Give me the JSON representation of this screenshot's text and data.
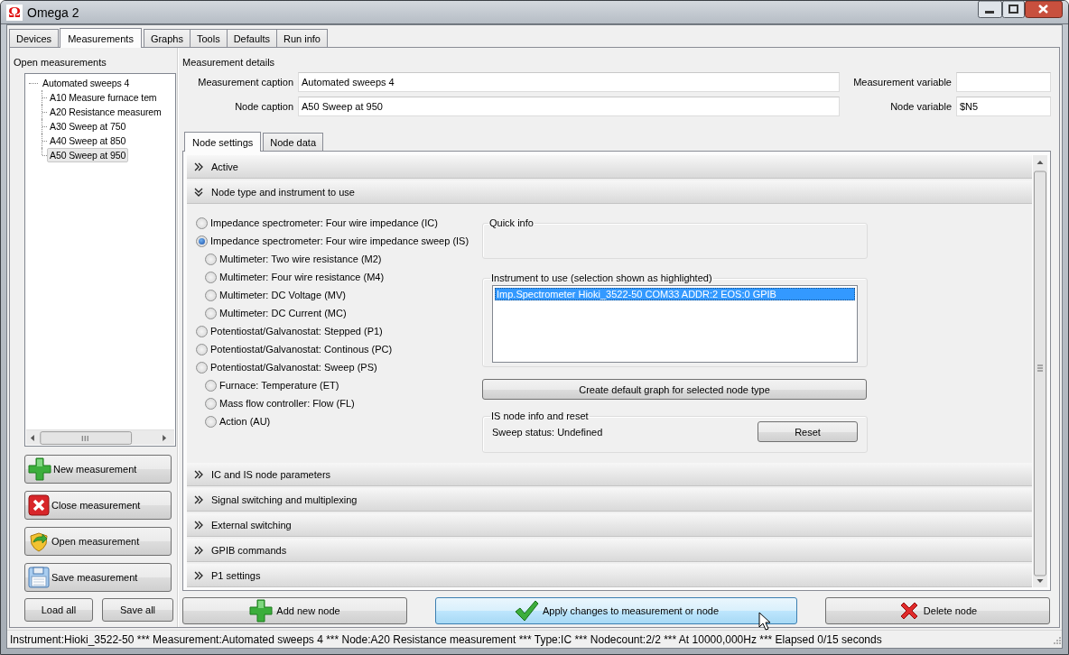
{
  "window": {
    "logo": "Ω",
    "title": "Omega 2"
  },
  "tabs": [
    {
      "label": "Devices",
      "selected": false
    },
    {
      "label": "Measurements",
      "selected": true
    },
    {
      "label": "Graphs",
      "selected": false
    },
    {
      "label": "Tools",
      "selected": false
    },
    {
      "label": "Defaults",
      "selected": false
    },
    {
      "label": "Run info",
      "selected": false
    }
  ],
  "open_measurements": {
    "title": "Open measurements",
    "tree": [
      {
        "label": "Automated sweeps 4",
        "selected": false,
        "children": [
          {
            "label": "A10 Measure furnace tem",
            "selected": false
          },
          {
            "label": "A20 Resistance measurem",
            "selected": false
          },
          {
            "label": "A30 Sweep at 750",
            "selected": false
          },
          {
            "label": "A40 Sweep at 850",
            "selected": false
          },
          {
            "label": "A50 Sweep at 950",
            "selected": true
          }
        ]
      }
    ],
    "buttons": [
      {
        "label": "New measurement",
        "kind": "add"
      },
      {
        "label": "Close measurement",
        "kind": "close"
      },
      {
        "label": "Open measurement",
        "kind": "open"
      },
      {
        "label": "Save measurement",
        "kind": "save"
      }
    ],
    "small_buttons": [
      "Load all",
      "Save all"
    ]
  },
  "measurement_details": {
    "title": "Measurement details",
    "fields": [
      {
        "label": "Measurement caption",
        "value": "Automated sweeps 4"
      },
      {
        "label": "Measurement variable"
      },
      {
        "label": "Node caption",
        "value": "A50 Sweep at 950"
      },
      {
        "label": "Node variable",
        "value": "$N5"
      }
    ]
  },
  "node_tabs": [
    {
      "label": "Node settings",
      "selected": true
    },
    {
      "label": "Node data",
      "selected": false
    }
  ],
  "sections": [
    {
      "title": "Active",
      "expanded": false
    },
    {
      "title": "Node type and instrument to use",
      "expanded": true,
      "body": {
        "node_types": [
          {
            "label": "Impedance spectrometer: Four wire impedance (IC)",
            "kind": "main",
            "selected": false
          },
          {
            "label": "Impedance spectrometer: Four wire impedance sweep (IS)",
            "kind": "main",
            "selected": true
          },
          {
            "label": "Multimeter: Two wire resistance (M2)",
            "kind": "sub",
            "selected": false
          },
          {
            "label": "Multimeter: Four wire resistance (M4)",
            "kind": "sub",
            "selected": false
          },
          {
            "label": "Multimeter: DC Voltage (MV)",
            "kind": "sub",
            "selected": false
          },
          {
            "label": "Multimeter: DC Current (MC)",
            "kind": "sub",
            "selected": false
          },
          {
            "label": "Potentiostat/Galvanostat: Stepped (P1)",
            "kind": "main",
            "selected": false
          },
          {
            "label": "Potentiostat/Galvanostat: Continous (PC)",
            "kind": "main",
            "selected": false
          },
          {
            "label": "Potentiostat/Galvanostat: Sweep (PS)",
            "kind": "main",
            "selected": false
          },
          {
            "label": "Furnace: Temperature (ET)",
            "kind": "sub",
            "selected": false
          },
          {
            "label": "Mass flow controller: Flow (FL)",
            "kind": "sub",
            "selected": false
          },
          {
            "label": "Action (AU)",
            "kind": "sub",
            "selected": false
          }
        ],
        "quick_info": {
          "title": "Quick info"
        },
        "instrument": {
          "title": "Instrument to use (selection shown as highlighted)",
          "items": [
            {
              "label": "Imp.Spectrometer Hioki_3522-50 COM33 ADDR:2 EOS:0 GPIB",
              "selected": true
            }
          ]
        },
        "graph_button": "Create default graph for selected node type",
        "is_node": {
          "title": "IS node info and reset",
          "status": "Sweep status: Undefined",
          "button": "Reset"
        }
      }
    },
    {
      "title": "IC and IS node parameters",
      "expanded": false
    },
    {
      "title": "Signal switching and multiplexing",
      "expanded": false
    },
    {
      "title": "External switching",
      "expanded": false
    },
    {
      "title": "GPIB commands",
      "expanded": false
    },
    {
      "title": "P1 settings",
      "expanded": false
    }
  ],
  "actions": [
    {
      "label": "Add new node",
      "kind": "add",
      "hovered": false
    },
    {
      "label": "Apply changes to measurement or node",
      "kind": "apply",
      "hovered": true
    },
    {
      "label": "Delete node",
      "kind": "delete",
      "hovered": false
    }
  ],
  "status_bar": "Instrument:Hioki_3522-50 *** Measurement:Automated sweeps 4 *** Node:A20 Resistance measurement *** Type:IC *** Nodecount:2/2 *** At 10000,000Hz *** Elapsed 0/15 seconds"
}
